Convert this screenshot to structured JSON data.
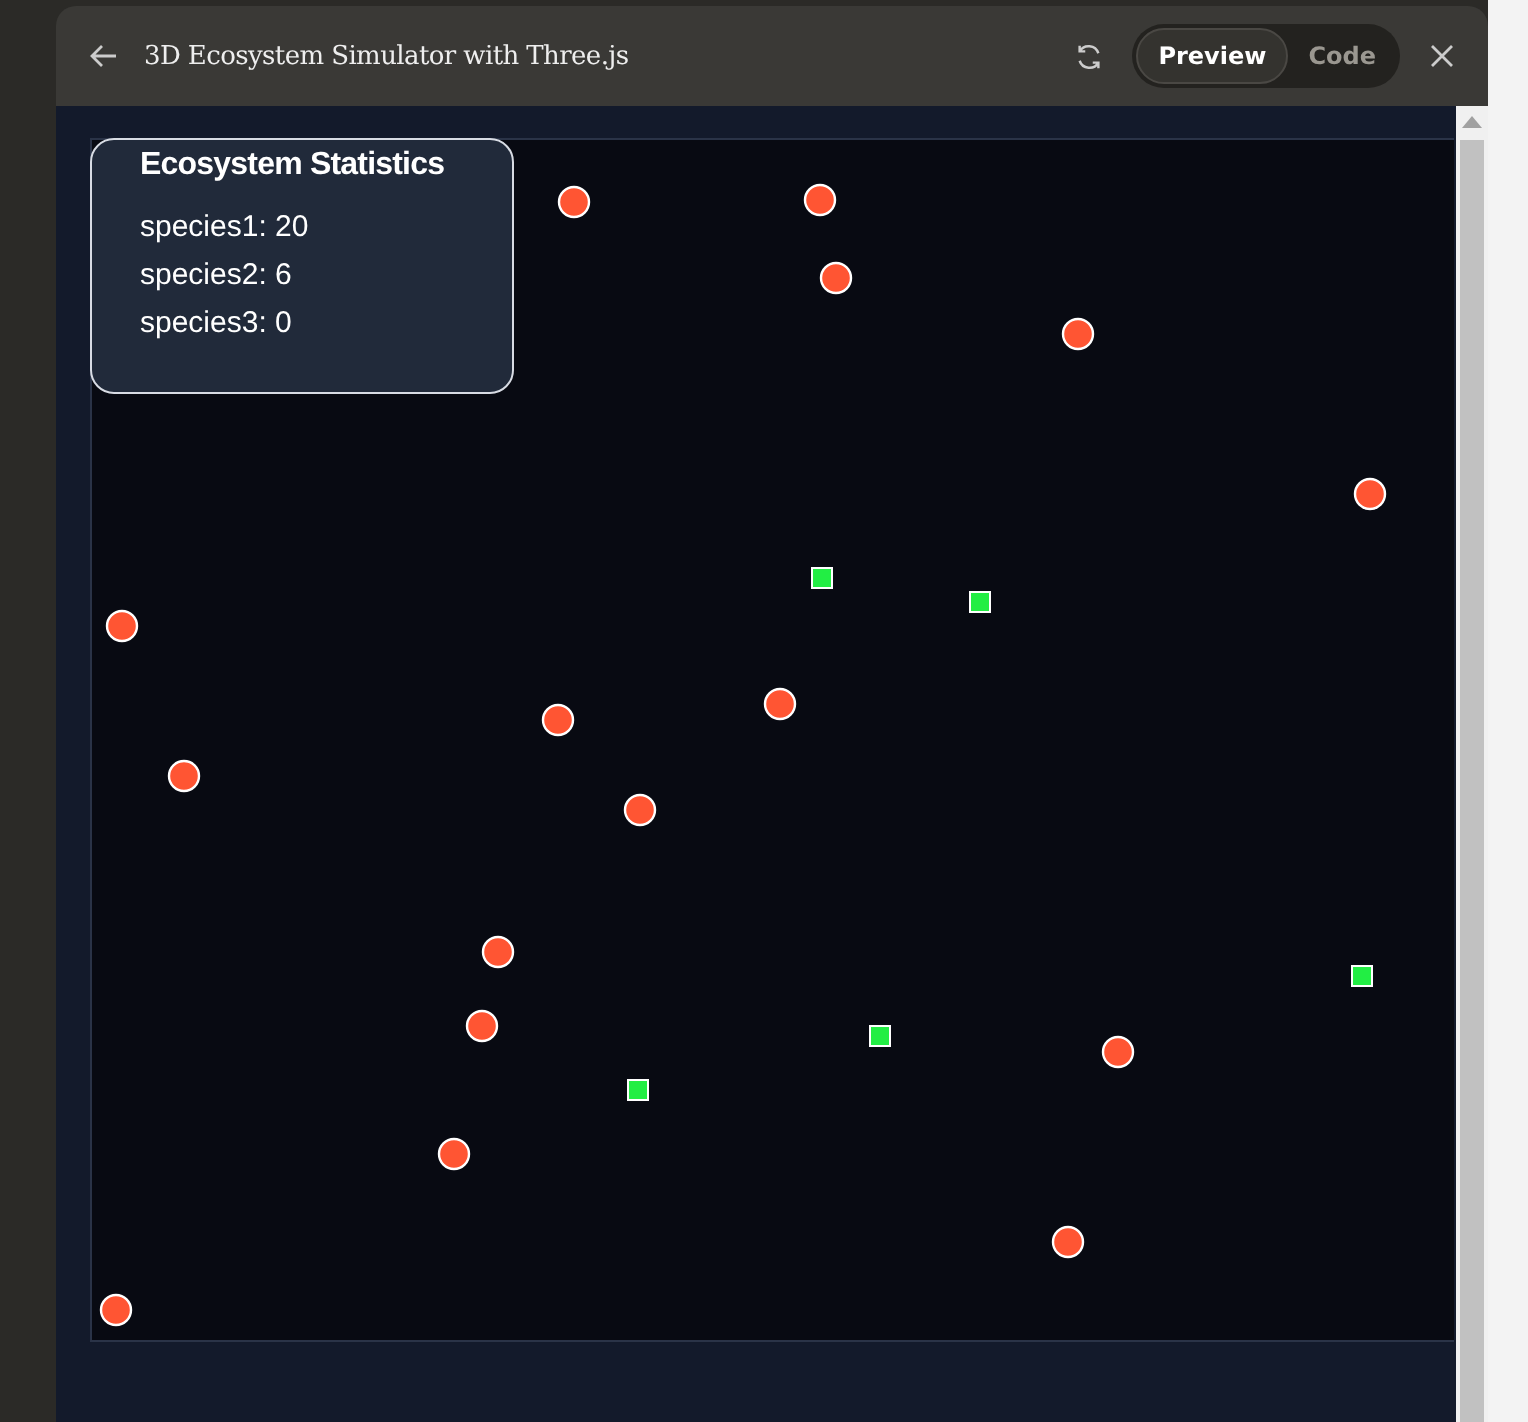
{
  "window": {
    "title": "3D Ecosystem Simulator with Three.js"
  },
  "view_toggle": [
    {
      "label": "Preview",
      "selected": true
    },
    {
      "label": "Code",
      "selected": false
    }
  ],
  "stats": {
    "title": "Ecosystem Statistics",
    "lines": [
      "species1: 20",
      "species2: 6",
      "species3: 0"
    ]
  }
}
